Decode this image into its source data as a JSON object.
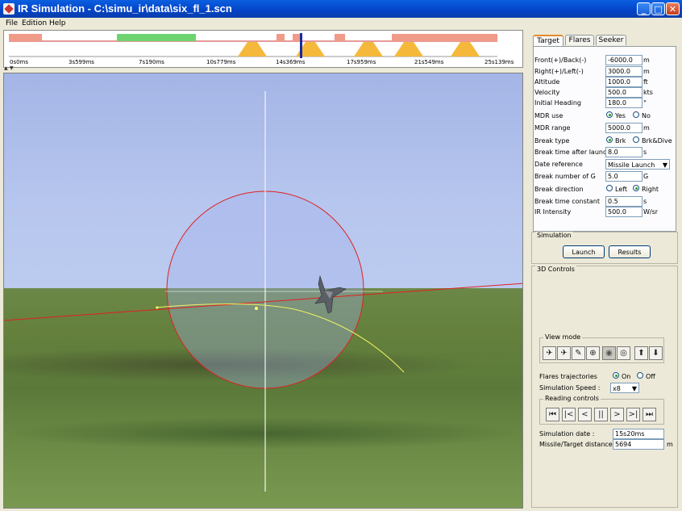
{
  "window": {
    "title": "IR Simulation - C:\\simu_ir\\data\\six_fl_1.scn",
    "minimize": "_",
    "maximize": "□",
    "close": "✕"
  },
  "menu": [
    "File",
    "Edition",
    "Help"
  ],
  "timeline": {
    "ticks": [
      "0s0ms",
      "3s599ms",
      "7s190ms",
      "10s779ms",
      "14s369ms",
      "17s959ms",
      "21s549ms",
      "25s139ms"
    ]
  },
  "splitter": {
    "left": "▲",
    "right": "▼"
  },
  "tabs": [
    "Target",
    "Flares",
    "Seeker"
  ],
  "target": {
    "front_back": {
      "label": "Front(+)/Back(-)",
      "value": "-6000.0",
      "unit": "m"
    },
    "right_left": {
      "label": "Right(+)/Left(-)",
      "value": "3000.0",
      "unit": "m"
    },
    "altitude": {
      "label": "Altitude",
      "value": "1000.0",
      "unit": "ft"
    },
    "velocity": {
      "label": "Velocity",
      "value": "500.0",
      "unit": "kts"
    },
    "heading": {
      "label": "Initial Heading",
      "value": "180.0",
      "unit": "°"
    },
    "mdr_use": {
      "label": "MDR use",
      "opt1": "Yes",
      "opt2": "No"
    },
    "mdr_range": {
      "label": "MDR range",
      "value": "5000.0",
      "unit": "m"
    },
    "break_type": {
      "label": "Break type",
      "opt1": "Brk",
      "opt2": "Brk&Dive"
    },
    "break_time": {
      "label": "Break time after launch",
      "value": "8.0",
      "unit": "s"
    },
    "date_ref": {
      "label": "Date reference",
      "value": "Missile Launch"
    },
    "break_g": {
      "label": "Break number of G",
      "value": "5.0",
      "unit": "G"
    },
    "break_dir": {
      "label": "Break direction",
      "opt1": "Left",
      "opt2": "Right"
    },
    "break_const": {
      "label": "Break time constant",
      "value": "0.5",
      "unit": "s"
    },
    "ir_intensity": {
      "label": "IR Intensity",
      "value": "500.0",
      "unit": "W/sr"
    }
  },
  "simulation": {
    "title": "Simulation",
    "launch": "Launch",
    "results": "Results"
  },
  "controls3d": {
    "title": "3D Controls",
    "view_mode": "View mode",
    "view_icons": [
      "✈",
      "✈",
      "✎",
      "⊕",
      "◉",
      "◎",
      "⬆",
      "⬇"
    ],
    "flares_traj": {
      "label": "Flares trajectories",
      "opt1": "On",
      "opt2": "Off"
    },
    "sim_speed": {
      "label": "Simulation Speed :",
      "value": "x8"
    },
    "reading": "Reading controls",
    "reading_icons": [
      "⏮",
      "|<",
      "<",
      "||",
      ">",
      ">|",
      "⏭"
    ],
    "sim_date": {
      "label": "Simulation date :",
      "value": "15s20ms"
    },
    "distance": {
      "label": "Missile/Target distance :",
      "value": "5694",
      "unit": "m"
    }
  }
}
